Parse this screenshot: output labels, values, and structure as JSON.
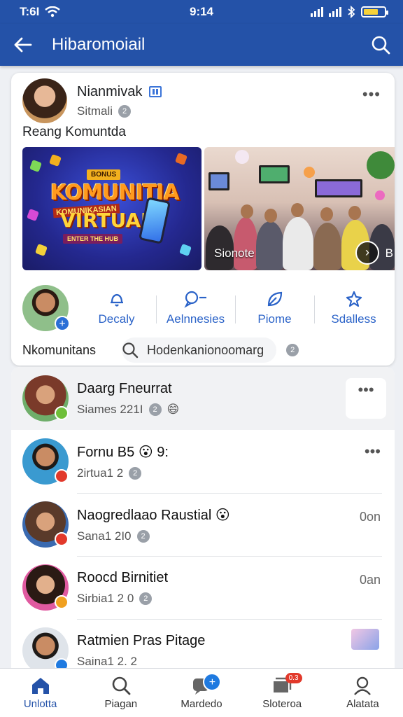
{
  "status_bar": {
    "left_text": "T:6I",
    "time": "9:14",
    "battery_level": 0.7
  },
  "app_bar": {
    "title": "Hibaromoiail"
  },
  "post": {
    "author": "Nianmivak",
    "sub": "Sitmali",
    "text": "Reang Komuntda",
    "banner": {
      "tag": "BONUS",
      "line1": "KOMUNITIA",
      "line2": "KOMUNIKASIAN",
      "line3": "VIRTUAL",
      "footer": "ENTER THE HUB"
    },
    "photo_caption": "Sionote",
    "photo_edge": "B",
    "actions": [
      {
        "label": "Decaly",
        "icon": "bell-icon"
      },
      {
        "label": "Aelnnesies",
        "icon": "chat-icon"
      },
      {
        "label": "Piome",
        "icon": "leaf-icon"
      },
      {
        "label": "Sdalless",
        "icon": "star-icon"
      }
    ],
    "search_label": "Nkomunitans",
    "search_text": "Hodenkanionoomarg"
  },
  "chats": [
    {
      "name": "Daarg Fneurrat",
      "meta": "Siames 221I",
      "emoji": "😄",
      "time": "",
      "status_color": "#6fbf3a"
    },
    {
      "name": "Fornu B5 😮 9:",
      "meta": "2irtua1 2",
      "time": "",
      "status_color": "#e2392b"
    },
    {
      "name": "Naogredlaao Raustial 😮",
      "meta": "Sana1 2I0",
      "time": "0on",
      "status_color": "#e2392b"
    },
    {
      "name": "Roocd Birnitiet",
      "meta": "Sirbia1 2 0",
      "time": "0an",
      "status_color": "#f0a020"
    },
    {
      "name": "Ratmien Pras Pitage",
      "meta": "Saina1 2. 2",
      "time": "",
      "status_color": "#1f7ae0"
    }
  ],
  "bottom_nav": [
    {
      "label": "Unlotta",
      "icon": "home-icon",
      "badge": ""
    },
    {
      "label": "Piagan",
      "icon": "search-icon",
      "badge": ""
    },
    {
      "label": "Mardedo",
      "icon": "messages-icon",
      "badge": "+"
    },
    {
      "label": "Sloteroa",
      "icon": "inbox-icon",
      "badge": "0.3"
    },
    {
      "label": "Alatata",
      "icon": "profile-icon",
      "badge": ""
    }
  ],
  "colors": {
    "brand": "#2452a8",
    "accent": "#2b63c8",
    "alert": "#e2392b"
  }
}
